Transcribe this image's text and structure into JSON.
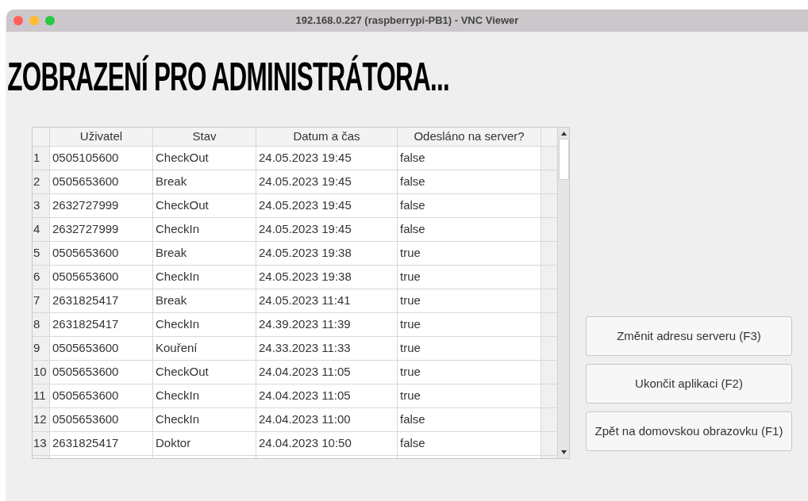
{
  "window": {
    "title": "192.168.0.227 (raspberrypi-PB1) - VNC Viewer"
  },
  "heading": "ZOBRAZENÍ PRO ADMINISTRÁTORA...",
  "table": {
    "columns": [
      "Uživatel",
      "Stav",
      "Datum a čas",
      "Odesláno na server?"
    ],
    "rows": [
      {
        "number": "1",
        "cells": [
          "0505105600",
          "CheckOut",
          "24.05.2023 19:45",
          "false"
        ]
      },
      {
        "number": "2",
        "cells": [
          "0505653600",
          "Break",
          "24.05.2023 19:45",
          "false"
        ]
      },
      {
        "number": "3",
        "cells": [
          "2632727999",
          "CheckOut",
          "24.05.2023 19:45",
          "false"
        ]
      },
      {
        "number": "4",
        "cells": [
          "2632727999",
          "CheckIn",
          "24.05.2023 19:45",
          "false"
        ]
      },
      {
        "number": "5",
        "cells": [
          "0505653600",
          "Break",
          "24.05.2023 19:38",
          "true"
        ]
      },
      {
        "number": "6",
        "cells": [
          "0505653600",
          "CheckIn",
          "24.05.2023 19:38",
          "true"
        ]
      },
      {
        "number": "7",
        "cells": [
          "2631825417",
          "Break",
          "24.05.2023 11:41",
          "true"
        ]
      },
      {
        "number": "8",
        "cells": [
          "2631825417",
          "CheckIn",
          "24.39.2023 11:39",
          "true"
        ]
      },
      {
        "number": "9",
        "cells": [
          "0505653600",
          "Kouření",
          "24.33.2023 11:33",
          "true"
        ]
      },
      {
        "number": "10",
        "cells": [
          "0505653600",
          "CheckOut",
          "24.04.2023 11:05",
          "true"
        ]
      },
      {
        "number": "11",
        "cells": [
          "0505653600",
          "CheckIn",
          "24.04.2023 11:05",
          "true"
        ]
      },
      {
        "number": "12",
        "cells": [
          "0505653600",
          "CheckIn",
          "24.04.2023 11:00",
          "false"
        ]
      },
      {
        "number": "13",
        "cells": [
          "2631825417",
          "Doktor",
          "24.04.2023 10:50",
          "false"
        ]
      }
    ]
  },
  "buttons": [
    "Změnit adresu serveru (F3)",
    "Ukončit aplikaci (F2)",
    "Zpět na domovskou obrazovku (F1)"
  ]
}
